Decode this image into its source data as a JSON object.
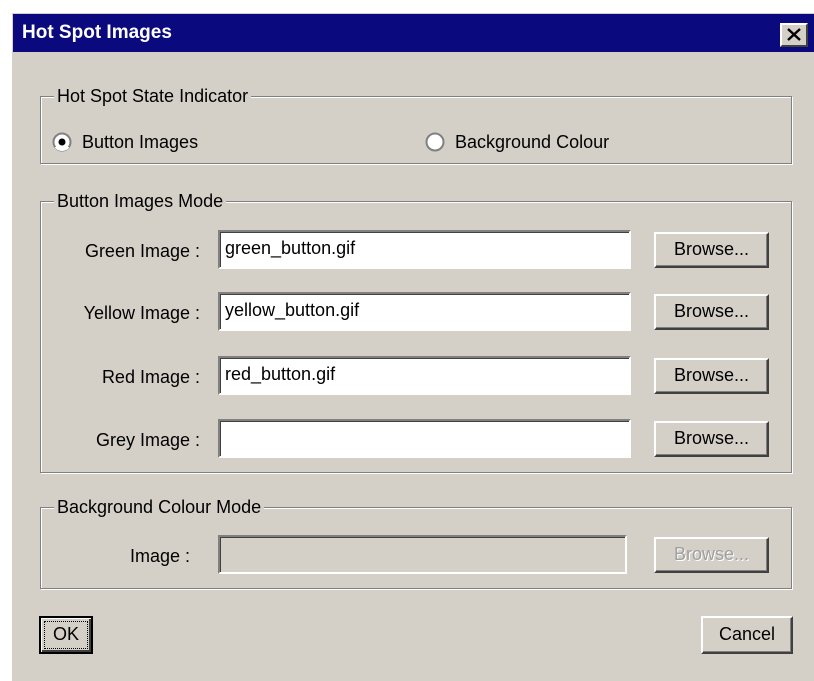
{
  "dialog": {
    "title": "Hot Spot Images",
    "close_icon": "close-icon"
  },
  "state_group": {
    "legend": "Hot Spot State Indicator",
    "options": [
      {
        "label": "Button Images",
        "selected": true
      },
      {
        "label": "Background Colour",
        "selected": false
      }
    ]
  },
  "button_images_group": {
    "legend": "Button Images Mode",
    "rows": [
      {
        "label": "Green Image :",
        "value": "green_button.gif",
        "browse": "Browse..."
      },
      {
        "label": "Yellow Image :",
        "value": "yellow_button.gif",
        "browse": "Browse..."
      },
      {
        "label": "Red Image :",
        "value": "red_button.gif",
        "browse": "Browse..."
      },
      {
        "label": "Grey Image :",
        "value": "",
        "browse": "Browse..."
      }
    ]
  },
  "background_group": {
    "legend": "Background Colour Mode",
    "label": "Image :",
    "value": "",
    "browse": "Browse...",
    "disabled": true
  },
  "footer": {
    "ok": "OK",
    "cancel": "Cancel"
  },
  "colors": {
    "titlebar": "#0a0a7e",
    "face": "#d4d0c8"
  }
}
